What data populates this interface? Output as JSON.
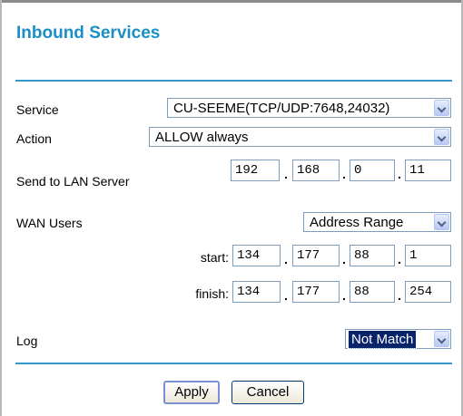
{
  "page": {
    "title": "Inbound Services"
  },
  "service": {
    "label": "Service",
    "value": "CU-SEEME(TCP/UDP:7648,24032)"
  },
  "action": {
    "label": "Action",
    "value": "ALLOW always"
  },
  "lan_server": {
    "label": "Send to LAN Server",
    "octets": [
      "192",
      "168",
      "0",
      "11"
    ]
  },
  "wan_users": {
    "label": "WAN Users",
    "value": "Address Range"
  },
  "start": {
    "label": "start:",
    "octets": [
      "134",
      "177",
      "88",
      "1"
    ]
  },
  "finish": {
    "label": "finish:",
    "octets": [
      "134",
      "177",
      "88",
      "254"
    ]
  },
  "log": {
    "label": "Log",
    "value": "Not Match"
  },
  "buttons": {
    "apply": "Apply",
    "cancel": "Cancel"
  },
  "colors": {
    "title": "#1a8fc4",
    "rule": "#3399cc",
    "selection": "#0a246a"
  },
  "icons": {
    "dropdown": "chevron-down-icon"
  }
}
